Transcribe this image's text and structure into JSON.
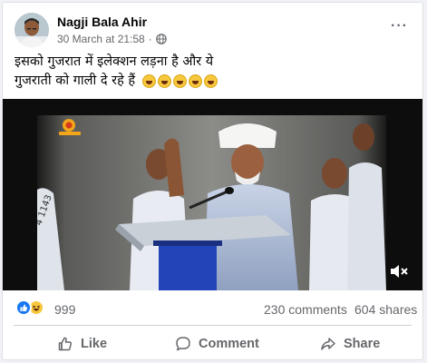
{
  "post": {
    "author": "Nagji Bala Ahir",
    "timestamp": "30 March at 21:58",
    "privacy_icon": "globe-icon",
    "caption_line1": "इसको गुजरात में इलेक्शन लड़ना है और ये",
    "caption_line2": "गुजराती को गाली दे रहे हैं",
    "caption_emoji_count": 5,
    "more_icon": "more-options-icon",
    "more_label": "···"
  },
  "video": {
    "channel_watermark": "mango-news-logo",
    "mute_icon": "volume-muted-icon"
  },
  "stats": {
    "reaction_icons": [
      "like-reaction-icon",
      "haha-reaction-icon"
    ],
    "reactions_count": "999",
    "comments": "230 comments",
    "shares": "604 shares"
  },
  "actions": {
    "like_label": "Like",
    "comment_label": "Comment",
    "share_label": "Share"
  },
  "colors": {
    "accent": "#1877f2",
    "secondary_text": "#65676b",
    "haha": "#f7c83b"
  }
}
